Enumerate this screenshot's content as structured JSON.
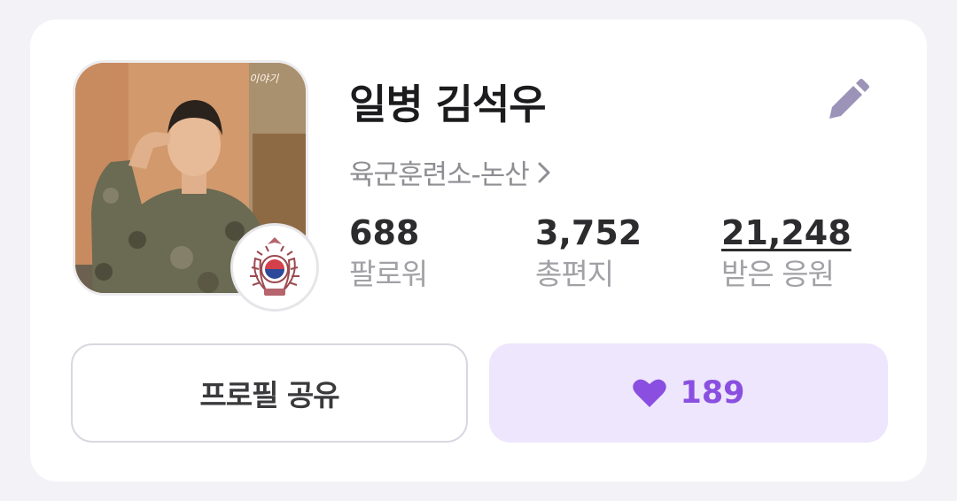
{
  "profile": {
    "name": "일병 김석우",
    "unit": "육군훈련소-논산",
    "photo_overlay_text": "이야기"
  },
  "stats": [
    {
      "value": "688",
      "label": "팔로워"
    },
    {
      "value": "3,752",
      "label": "총편지"
    },
    {
      "value": "21,248",
      "label": "받은 응원"
    }
  ],
  "actions": {
    "share_label": "프로필 공유",
    "like_count": "189"
  },
  "icons": {
    "edit": "pencil-icon",
    "chevron": "chevron-right-icon",
    "heart": "heart-icon",
    "emblem": "army-emblem-icon"
  },
  "colors": {
    "accent": "#8a4fe0",
    "accent_bg": "#ede6fc",
    "pencil": "#9b93b8",
    "muted_text": "#8e8e93"
  }
}
